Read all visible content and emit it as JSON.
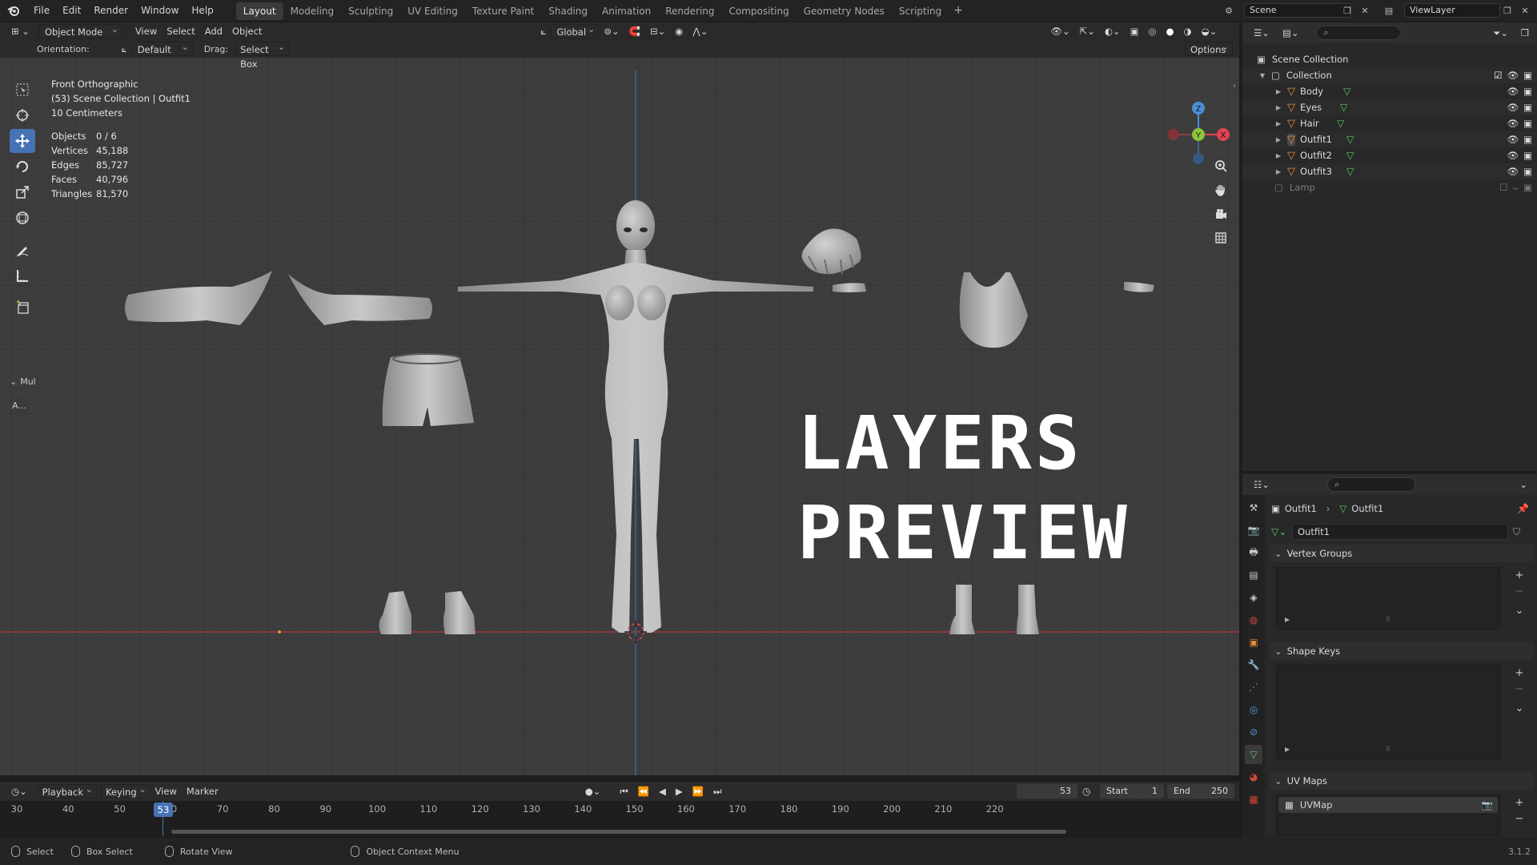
{
  "topbar": {
    "menus": [
      "File",
      "Edit",
      "Render",
      "Window",
      "Help"
    ],
    "workspaces": [
      "Layout",
      "Modeling",
      "Sculpting",
      "UV Editing",
      "Texture Paint",
      "Shading",
      "Animation",
      "Rendering",
      "Compositing",
      "Geometry Nodes",
      "Scripting"
    ],
    "active_workspace": "Layout",
    "scene_name": "Scene",
    "view_layer": "ViewLayer"
  },
  "viewport": {
    "mode": "Object Mode",
    "menus": [
      "View",
      "Select",
      "Add",
      "Object"
    ],
    "transform_orientation": "Global",
    "tool_settings": {
      "orientation_label": "Orientation:",
      "orientation_value": "Default",
      "drag_label": "Drag:",
      "drag_value": "Select Box",
      "options": "Options"
    },
    "info": {
      "view_name": "Front Orthographic",
      "collection": "(53) Scene Collection | Outfit1",
      "scale": "10 Centimeters"
    },
    "stats": [
      {
        "label": "Objects",
        "value": "0 / 6"
      },
      {
        "label": "Vertices",
        "value": "45,188"
      },
      {
        "label": "Edges",
        "value": "85,727"
      },
      {
        "label": "Faces",
        "value": "40,796"
      },
      {
        "label": "Triangles",
        "value": "81,570"
      }
    ],
    "overlay_title_line1": "LAYERS",
    "overlay_title_line2": "PREVIEW",
    "side_panel_label": "Mul",
    "side_panel_button": "A...",
    "gizmo_labels": {
      "z": "Z",
      "y": "Y",
      "x": "X"
    }
  },
  "timeline": {
    "menus": [
      "Playback",
      "Keying",
      "View",
      "Marker"
    ],
    "current_frame": "53",
    "start_label": "Start",
    "start_value": "1",
    "end_label": "End",
    "end_value": "250",
    "ticks": [
      "30",
      "40",
      "50",
      "60",
      "70",
      "80",
      "90",
      "100",
      "110",
      "120",
      "130",
      "140",
      "150",
      "160",
      "170",
      "180",
      "190",
      "200",
      "210",
      "220"
    ],
    "playhead_label": "53"
  },
  "statusbar": {
    "select": "Select",
    "box_select": "Box Select",
    "rotate_view": "Rotate View",
    "context_menu": "Object Context Menu",
    "version": "3.1.2"
  },
  "outliner": {
    "scene_collection": "Scene Collection",
    "collection": "Collection",
    "objects": [
      "Body",
      "Eyes",
      "Hair",
      "Outfit1",
      "Outfit2",
      "Outfit3"
    ],
    "lamp": "Lamp"
  },
  "properties": {
    "breadcrumb_object": "Outfit1",
    "breadcrumb_data": "Outfit1",
    "mesh_name": "Outfit1",
    "panels": {
      "vertex_groups": "Vertex Groups",
      "shape_keys": "Shape Keys",
      "uv_maps": "UV Maps"
    },
    "uv_map_name": "UVMap"
  },
  "colors": {
    "accent": "#4772b3",
    "x_axis": "#e0454f",
    "y_axis": "#8bc53f",
    "z_axis": "#4a8fd6",
    "mesh_orange": "#e98a3a"
  }
}
